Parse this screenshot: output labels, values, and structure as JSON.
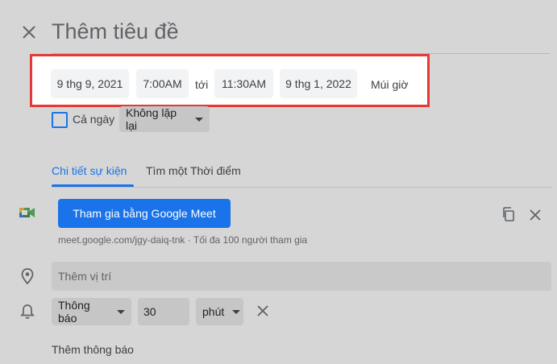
{
  "header": {
    "title_placeholder": "Thêm tiêu đề"
  },
  "datetime": {
    "start_date": "9 thg 9, 2021",
    "start_time": "7:00AM",
    "separator": "tới",
    "end_time": "11:30AM",
    "end_date": "9 thg 1, 2022",
    "timezone_label": "Múi giờ"
  },
  "options": {
    "all_day_label": "Cả ngày",
    "all_day_checked": false,
    "repeat_value": "Không lặp lại"
  },
  "tabs": [
    {
      "label": "Chi tiết sự kiện",
      "active": true
    },
    {
      "label": "Tìm một Thời điểm",
      "active": false
    }
  ],
  "meet": {
    "button_label": "Tham gia bằng Google Meet",
    "link_text": "meet.google.com/jgy-daiq-tnk · Tối đa 100 người tham gia"
  },
  "location": {
    "placeholder": "Thêm vị trí"
  },
  "notification": {
    "type_value": "Thông báo",
    "amount": "30",
    "unit_value": "phút",
    "add_label": "Thêm thông báo"
  },
  "colors": {
    "accent": "#1a73e8",
    "highlight_border": "#e53935",
    "overlay": "#d6d6d6"
  }
}
